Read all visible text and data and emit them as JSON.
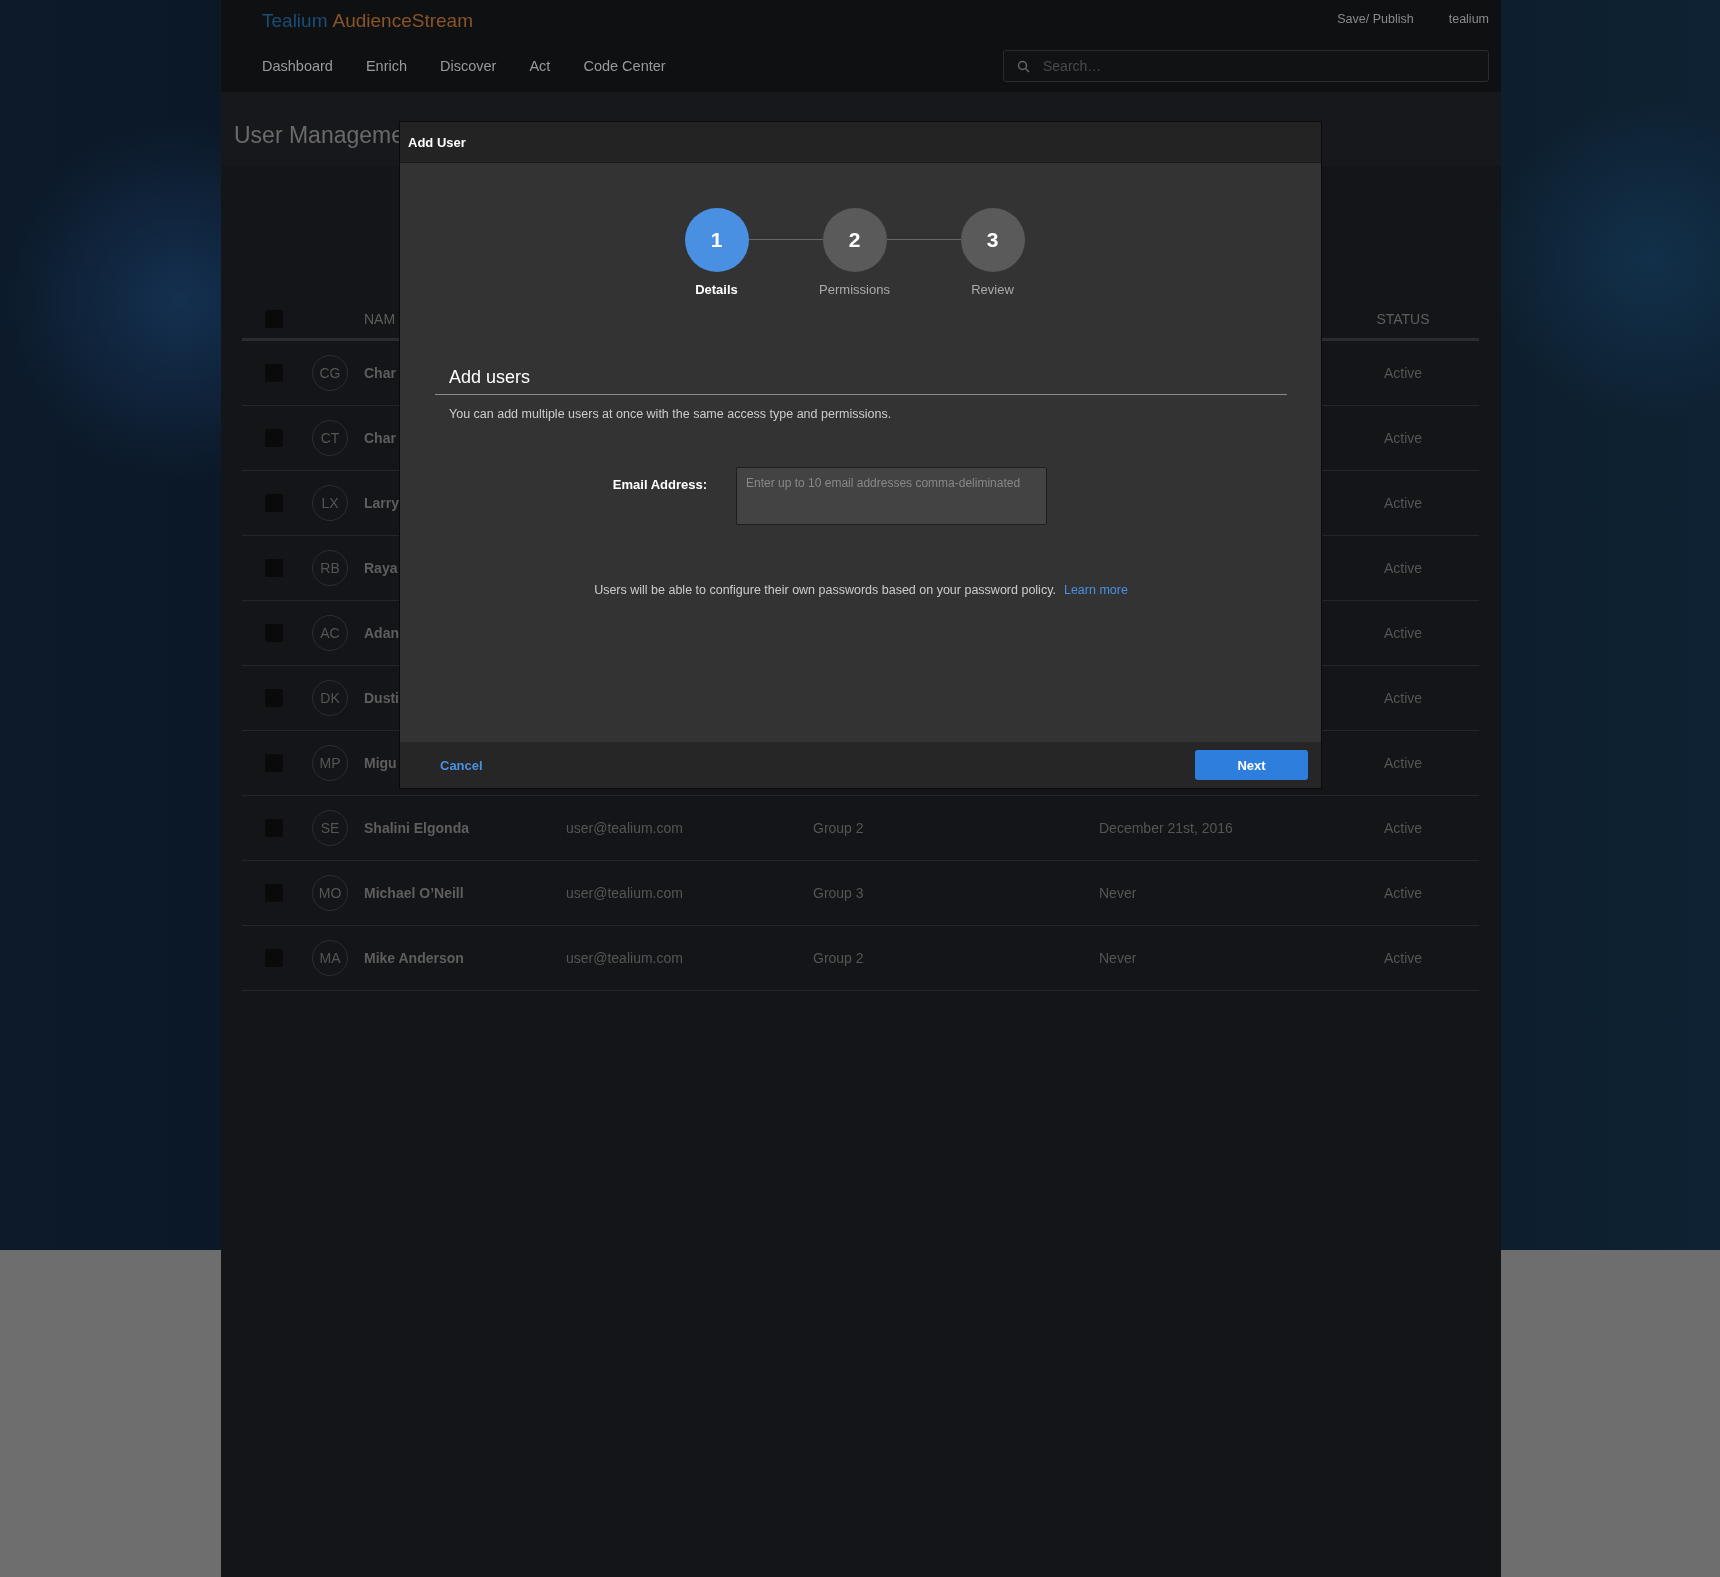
{
  "header": {
    "logo": {
      "brand": "Tealium",
      "product": "AudienceStream"
    },
    "actions": [
      "Save/ Publish",
      "tealium"
    ],
    "nav": [
      {
        "label": "Dashboard"
      },
      {
        "label": "Enrich"
      },
      {
        "label": "Discover"
      },
      {
        "label": "Act"
      },
      {
        "label": "Code Center"
      }
    ],
    "search": {
      "placeholder": "Search…"
    }
  },
  "page_title": "User Manageme",
  "table": {
    "header_checkbox": {
      "checked": false
    },
    "columns": [
      "NAM",
      "STATUS"
    ],
    "rows": [
      {
        "checked": false,
        "initials": "CG",
        "name": "Char",
        "status": "Active"
      },
      {
        "checked": false,
        "initials": "CT",
        "name": "Char",
        "status": "Active"
      },
      {
        "checked": false,
        "initials": "LX",
        "name": "Larry",
        "status": "Active"
      },
      {
        "checked": false,
        "initials": "RB",
        "name": "Raya",
        "status": "Active"
      },
      {
        "checked": false,
        "initials": "AC",
        "name": "Adan",
        "status": "Active"
      },
      {
        "checked": false,
        "initials": "DK",
        "name": "Dusti",
        "status": "Active"
      },
      {
        "checked": false,
        "initials": "MP",
        "name": "Migu",
        "status": "Active"
      },
      {
        "checked": false,
        "initials": "SE",
        "name": "Shalini Elgonda",
        "email": "user@tealium.com",
        "group": "Group 2",
        "last_login": "December 21st, 2016",
        "status": "Active"
      },
      {
        "checked": false,
        "initials": "MO",
        "name": "Michael O’Neill",
        "email": "user@tealium.com",
        "group": "Group 3",
        "last_login": "Never",
        "status": "Active"
      },
      {
        "checked": false,
        "initials": "MA",
        "name": "Mike Anderson",
        "email": "user@tealium.com",
        "group": "Group 2",
        "last_login": "Never",
        "status": "Active"
      }
    ]
  },
  "dialog": {
    "title": "Add User",
    "steps": [
      {
        "number": "1",
        "label": "Details",
        "selected": true
      },
      {
        "number": "2",
        "label": "Permissions",
        "selected": false
      },
      {
        "number": "3",
        "label": "Review",
        "selected": false
      }
    ],
    "heading": "Add users",
    "description": "You can add multiple users at once with the same access type and permissions.",
    "email_field": {
      "label": "Email Address:",
      "placeholder": "Enter up to 10 email addresses comma-deliminated"
    },
    "note": "Users will be able to configure their own passwords based on your password policy.",
    "note_link": "Learn more",
    "buttons": {
      "cancel": "Cancel",
      "next": "Next"
    }
  }
}
